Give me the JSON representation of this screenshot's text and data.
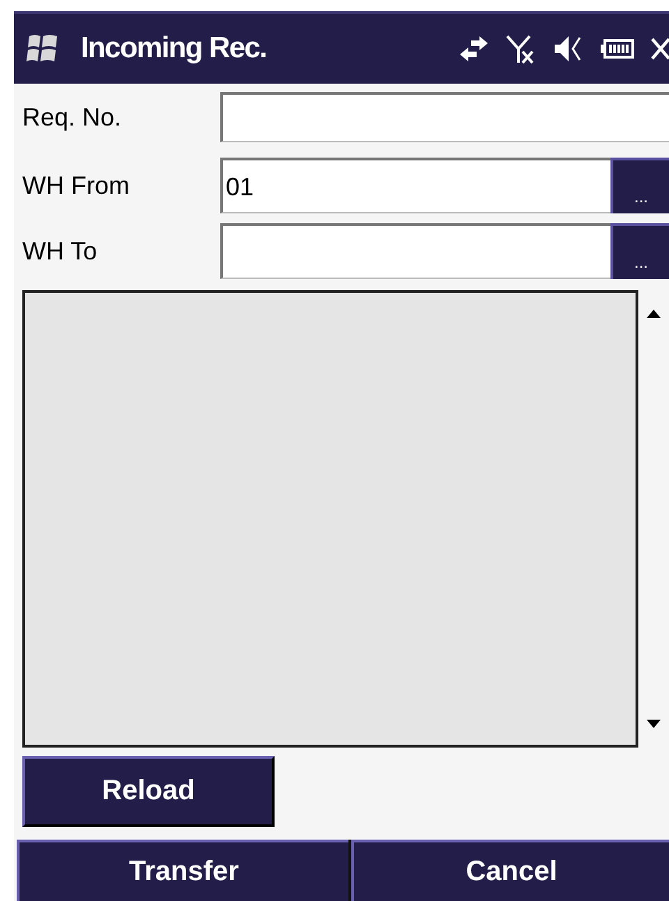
{
  "title_bar": {
    "title": "Incoming Rec."
  },
  "fields": [
    {
      "label": "Req. No.",
      "kind": "text"
    },
    {
      "label": "WH From",
      "kind": "lookup",
      "value": "01",
      "browse_label": "..."
    },
    {
      "label": "WH To",
      "kind": "lookup",
      "browse_label": "..."
    }
  ],
  "reload_button": "Reload",
  "bottom_buttons": [
    "Transfer",
    "Cancel"
  ]
}
